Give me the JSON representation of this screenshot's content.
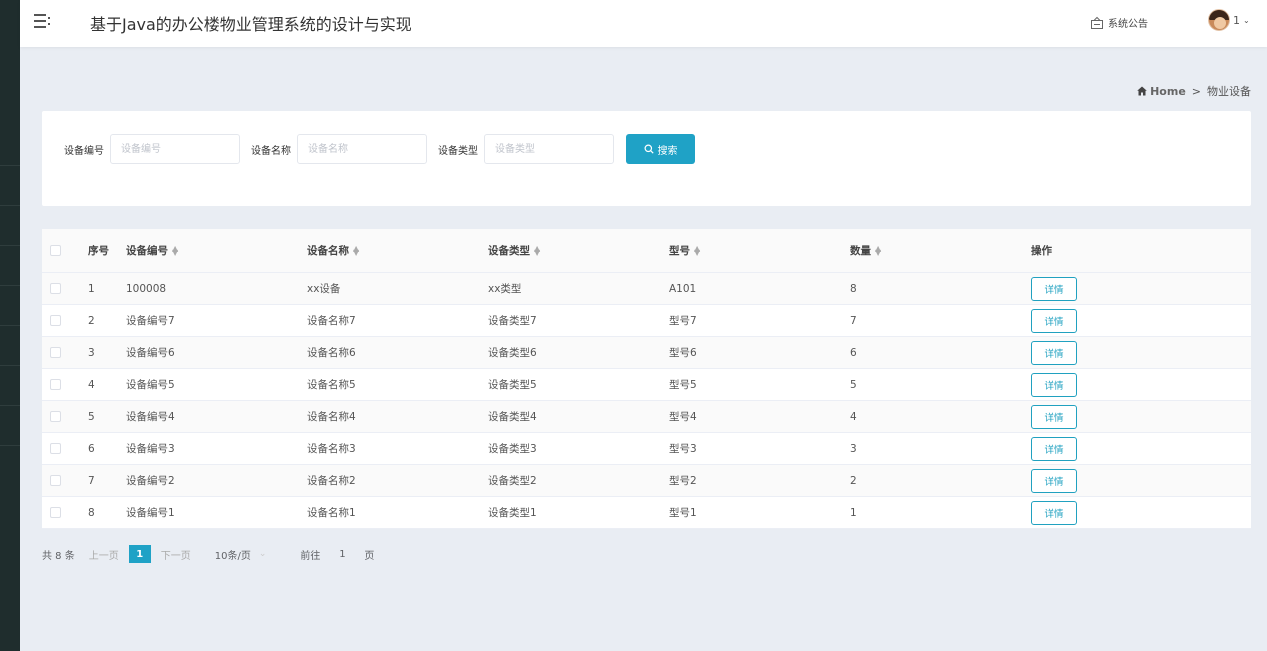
{
  "header": {
    "title": "基于Java的办公楼物业管理系统的设计与实现",
    "notice_label": "系统公告",
    "user_label": "1"
  },
  "breadcrumb": {
    "home": "Home",
    "separator": ">",
    "current": "物业设备"
  },
  "search": {
    "fields": [
      {
        "label": "设备编号",
        "placeholder": "设备编号",
        "value": ""
      },
      {
        "label": "设备名称",
        "placeholder": "设备名称",
        "value": ""
      },
      {
        "label": "设备类型",
        "placeholder": "设备类型",
        "value": ""
      }
    ],
    "button_label": "搜索"
  },
  "table": {
    "columns": {
      "idx": "序号",
      "no": "设备编号",
      "name": "设备名称",
      "type": "设备类型",
      "model": "型号",
      "qty": "数量",
      "op": "操作"
    },
    "detail_label": "详情",
    "rows": [
      {
        "idx": "1",
        "no": "100008",
        "name": "xx设备",
        "type": "xx类型",
        "model": "A101",
        "qty": "8"
      },
      {
        "idx": "2",
        "no": "设备编号7",
        "name": "设备名称7",
        "type": "设备类型7",
        "model": "型号7",
        "qty": "7"
      },
      {
        "idx": "3",
        "no": "设备编号6",
        "name": "设备名称6",
        "type": "设备类型6",
        "model": "型号6",
        "qty": "6"
      },
      {
        "idx": "4",
        "no": "设备编号5",
        "name": "设备名称5",
        "type": "设备类型5",
        "model": "型号5",
        "qty": "5"
      },
      {
        "idx": "5",
        "no": "设备编号4",
        "name": "设备名称4",
        "type": "设备类型4",
        "model": "型号4",
        "qty": "4"
      },
      {
        "idx": "6",
        "no": "设备编号3",
        "name": "设备名称3",
        "type": "设备类型3",
        "model": "型号3",
        "qty": "3"
      },
      {
        "idx": "7",
        "no": "设备编号2",
        "name": "设备名称2",
        "type": "设备类型2",
        "model": "型号2",
        "qty": "2"
      },
      {
        "idx": "8",
        "no": "设备编号1",
        "name": "设备名称1",
        "type": "设备类型1",
        "model": "型号1",
        "qty": "1"
      }
    ]
  },
  "pagination": {
    "total": "共 8 条",
    "prev": "上一页",
    "current_page": "1",
    "next": "下一页",
    "page_size": "10条/页",
    "goto_prefix": "前往",
    "goto_value": "1",
    "goto_suffix": "页"
  },
  "colors": {
    "accent": "#1fa2c6",
    "sidebar": "#1f2d2d",
    "background": "#e9edf3"
  },
  "icons": {
    "menu": "menu-icon",
    "notice": "notice-icon",
    "home": "home-icon",
    "search": "search-icon",
    "sort": "sort-icon",
    "dropdown": "chevron-down-icon"
  }
}
